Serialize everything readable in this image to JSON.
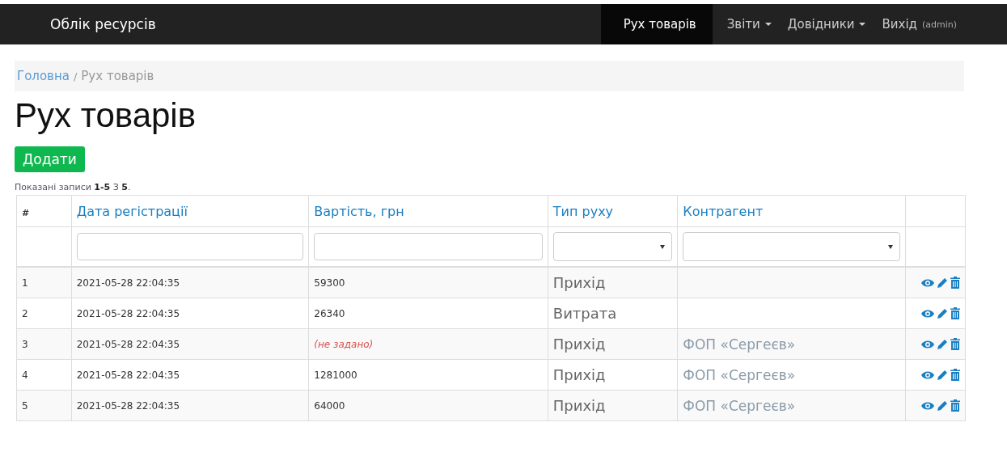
{
  "navbar": {
    "brand": "Облік ресурсів",
    "items": [
      {
        "label": "Рух товарів",
        "selected": true,
        "dropdown": false
      },
      {
        "label": "Звіти",
        "selected": false,
        "dropdown": true
      },
      {
        "label": "Довідники",
        "selected": false,
        "dropdown": true
      },
      {
        "label": "Вихід",
        "note": "(admin)",
        "selected": false,
        "dropdown": false
      }
    ]
  },
  "breadcrumb": [
    {
      "label": "Головна",
      "link": true
    },
    {
      "label": "Рух товарів",
      "link": false
    }
  ],
  "breadcrumb_separator": "/",
  "title": "Рух товарів",
  "add_button": "Додати",
  "summary": "Показані записи **1-5** З **5**.",
  "table": {
    "columns": [
      {
        "label": "#",
        "sortable": false
      },
      {
        "label": "Дата регістрації",
        "sortable": true
      },
      {
        "label": "Вартість, грн",
        "sortable": true
      },
      {
        "label": "Тип руху",
        "sortable": true
      },
      {
        "label": "Контрагент",
        "sortable": true
      }
    ],
    "filters": [
      {
        "kind": "none"
      },
      {
        "kind": "text"
      },
      {
        "kind": "text"
      },
      {
        "kind": "select"
      },
      {
        "kind": "select"
      },
      {
        "kind": "none"
      }
    ],
    "rows": [
      {
        "num": "1",
        "date": "2021-05-28 22:04:35",
        "cost": "59300",
        "cost_not_set": false,
        "type": "Прихід"
      },
      {
        "num": "2",
        "date": "2021-05-28 22:04:35",
        "cost": "26340",
        "cost_not_set": false,
        "type": "Витрата"
      },
      {
        "num": "3",
        "date": "2021-05-28 22:04:35",
        "cost": "(не задано)",
        "cost_not_set": true,
        "type": "Прихід",
        "counterparty": "ФОП «Сергеєв»"
      },
      {
        "num": "4",
        "date": "2021-05-28 22:04:35",
        "cost": "1281000",
        "cost_not_set": false,
        "type": "Прихід",
        "counterparty": "ФОП «Сергеєв»"
      },
      {
        "num": "5",
        "date": "2021-05-28 22:04:35",
        "cost": "64000",
        "cost_not_set": false,
        "type": "Прихід",
        "counterparty": "ФОП «Сергеєв»"
      }
    ]
  }
}
